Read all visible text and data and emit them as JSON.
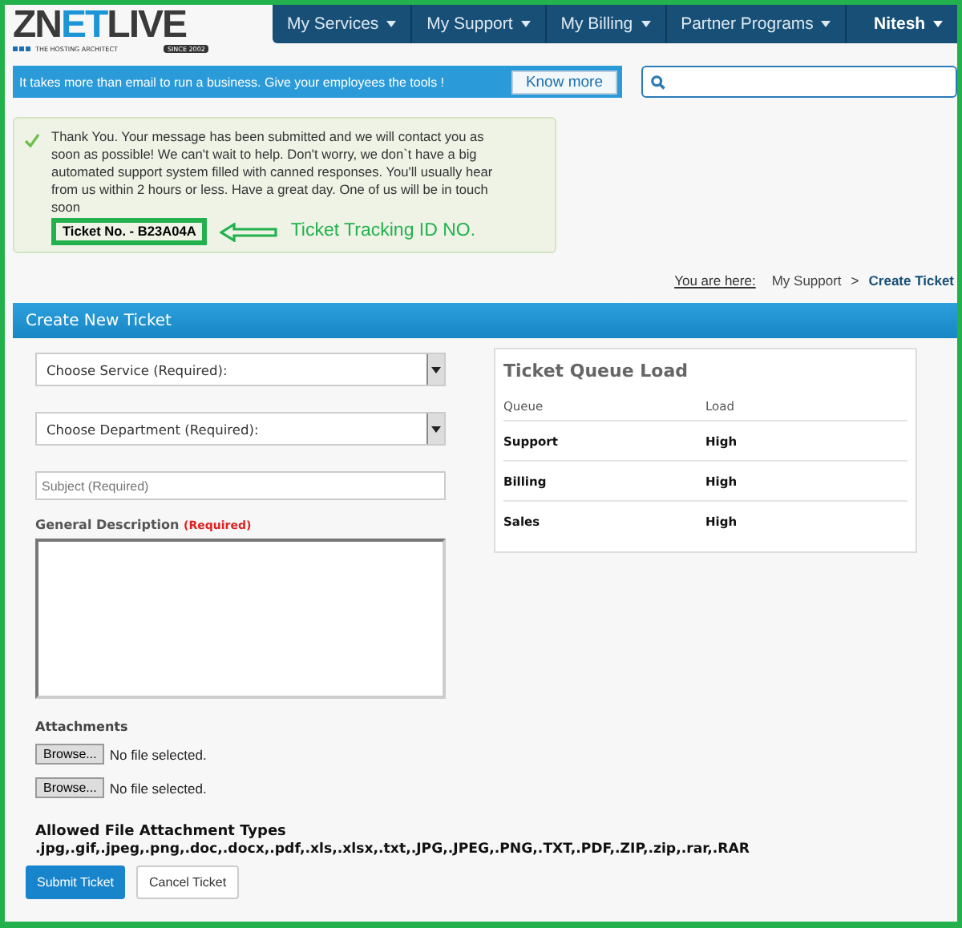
{
  "logo": {
    "name_dark": "ZN",
    "name_accent": "ET",
    "name_rest": "LIVE",
    "tagline": "THE HOSTING ARCHITECT",
    "since": "SINCE 2002"
  },
  "nav": [
    {
      "label": "My Services",
      "kind": "menu"
    },
    {
      "label": "My Support",
      "kind": "menu"
    },
    {
      "label": "My Billing",
      "kind": "menu"
    },
    {
      "label": "Partner Programs",
      "kind": "menu"
    },
    {
      "label": "Nitesh",
      "kind": "user"
    }
  ],
  "banner": {
    "text": "It takes more than email to run a business.  Give your employees the tools !",
    "button": "Know more"
  },
  "alert": {
    "message": "Thank You. Your message has been submitted and we will contact you as soon as possible! We can't wait to help. Don't worry, we don`t have a big automated support system filled with canned responses. You'll usually hear from us within 2 hours or less. Have a great day. One of us will be in touch soon",
    "ticket": "Ticket No. - B23A04A"
  },
  "annotation": {
    "label": "Ticket Tracking ID NO."
  },
  "breadcrumb": {
    "prefix": "You are here:",
    "separator": ">",
    "items": [
      {
        "label": "My Support",
        "selected": false
      },
      {
        "label": "Create Ticket",
        "selected": true
      }
    ]
  },
  "panel": {
    "title": "Create New Ticket"
  },
  "form": {
    "selects": [
      "Choose Service (Required):",
      "Choose Department (Required):"
    ],
    "subject_placeholder": "Subject (Required)",
    "description_label": "General Description",
    "required_mark": "(Required)",
    "attachments_label": "Attachments",
    "files": [
      {
        "button": "Browse...",
        "status": "No file selected."
      },
      {
        "button": "Browse...",
        "status": "No file selected."
      }
    ],
    "allowed_title": "Allowed File Attachment Types",
    "allowed_types": ".jpg,.gif,.jpeg,.png,.doc,.docx,.pdf,.xls,.xlsx,.txt,.JPG,.JPEG,.PNG,.TXT,.PDF,.ZIP,.zip,.rar,.RAR",
    "submit": "Submit Ticket",
    "cancel": "Cancel Ticket"
  },
  "queue": {
    "title": "Ticket Queue Load",
    "columns": [
      "Queue",
      "Load"
    ],
    "rows": [
      {
        "queue": "Support",
        "load": "High"
      },
      {
        "queue": "Billing",
        "load": "High"
      },
      {
        "queue": "Sales",
        "load": "High"
      }
    ]
  }
}
